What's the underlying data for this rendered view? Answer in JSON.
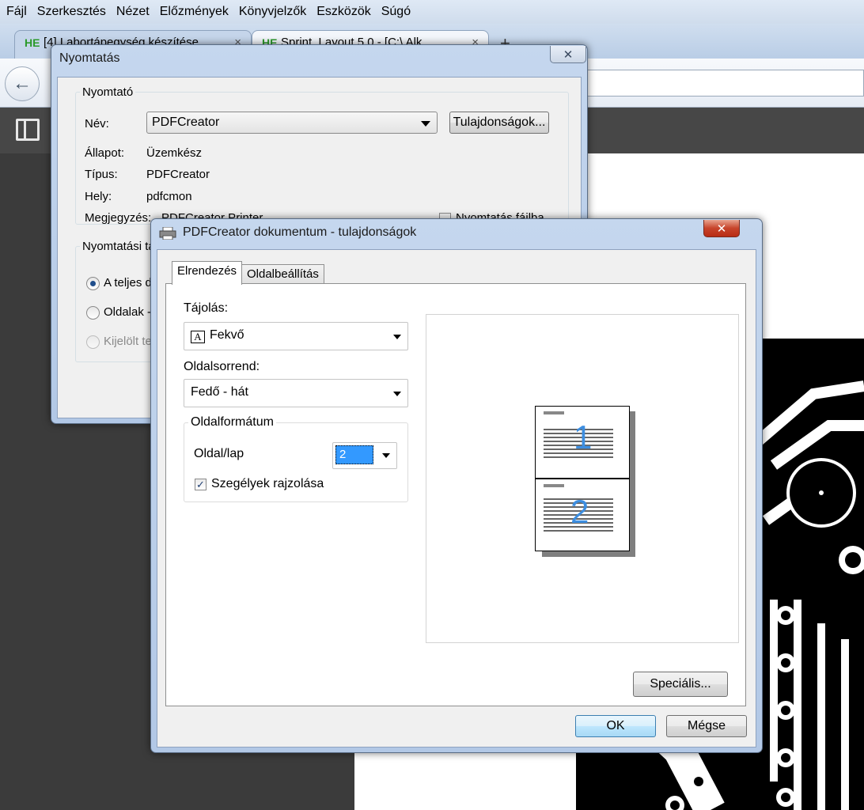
{
  "browser": {
    "menu": [
      "Fájl",
      "Szerkesztés",
      "Nézet",
      "Előzmények",
      "Könyvjelzők",
      "Eszközök",
      "Súgó"
    ],
    "tabs": [
      {
        "favicon": "HE",
        "label": "[4] Labortápegység készítése"
      },
      {
        "favicon": "HE",
        "label": "Sprint_Layout 5.0 - [C:\\ Alk..."
      }
    ],
    "tab_close": "×",
    "new_tab": "+"
  },
  "print_dialog": {
    "title": "Nyomtatás",
    "close": "✕",
    "printer_group": "Nyomtató",
    "name_label": "Név:",
    "name_value": "PDFCreator",
    "properties_button": "Tulajdonságok...",
    "status_label": "Állapot:",
    "status_value": "Üzemkész",
    "type_label": "Típus:",
    "type_value": "PDFCreator",
    "where_label": "Hely:",
    "where_value": "pdfcmon",
    "comment_label": "Megjegyzés:",
    "comment_value": "PDFCreator Printer",
    "print_to_file": "Nyomtatás fájlba",
    "range_group": "Nyomtatási tartomány",
    "range_all": "A teljes dokumentum",
    "range_pages": "Oldalak -tól",
    "range_selection": "Kijelölt terület"
  },
  "props_dialog": {
    "title": "PDFCreator dokumentum - tulajdonságok",
    "close": "✕",
    "tabs": {
      "layout": "Elrendezés",
      "page_setup": "Oldalbeállítás"
    },
    "orientation_label": "Tájolás:",
    "orientation_icon": "A",
    "orientation_value": "Fekvő",
    "page_order_label": "Oldalsorrend:",
    "page_order_value": "Fedő - hát",
    "page_format_group": "Oldalformátum",
    "pages_per_sheet_label": "Oldal/lap",
    "pages_per_sheet_value": "2",
    "draw_borders_label": "Szegélyek rajzolása",
    "draw_borders_checked": "✓",
    "preview_page_1": "1",
    "preview_page_2": "2",
    "advanced_button": "Speciális...",
    "ok_button": "OK",
    "cancel_button": "Mégse"
  },
  "colors": {
    "preview_number": "#3d8ee0",
    "selection": "#3399ff",
    "close_red": "#c7442b"
  }
}
